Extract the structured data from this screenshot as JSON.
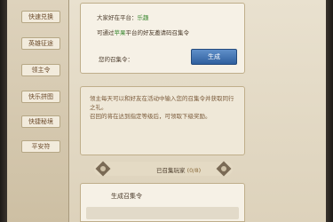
{
  "sidebar": {
    "items": [
      {
        "label": "快速兑换"
      },
      {
        "label": "英雄征途"
      },
      {
        "label": "领主令"
      },
      {
        "label": "快乐拼图"
      },
      {
        "label": "快捷秘境"
      },
      {
        "label": "平安符"
      }
    ]
  },
  "invite_panel": {
    "line1_prefix": "大家好在平台：",
    "line1_highlight": "乐趣",
    "line2_prefix": "可通过",
    "line2_highlight": "苹果",
    "line2_suffix": "平台的好友邀请码召集令",
    "code_label": "您的召集令：",
    "generate_button": "生成"
  },
  "info_panel": {
    "paragraphs": [
      "领主每天可以和好友在活动中输入您的召集令并获取同行之礼。",
      "召回的将在达到指定等级后，可领取下级奖励。"
    ]
  },
  "counter": {
    "label": "已召集玩家",
    "value": "(0/8)"
  },
  "generate_panel": {
    "title": "生成召集令"
  },
  "colors": {
    "accent_blue": "#2f5f9e",
    "highlight_green": "#3f8a35"
  }
}
